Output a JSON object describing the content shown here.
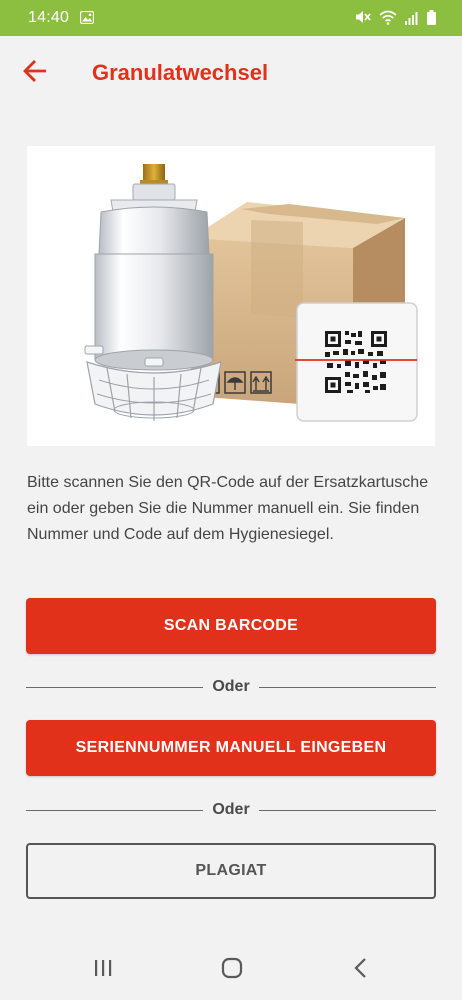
{
  "status_bar": {
    "time": "14:40",
    "icons": [
      "image-icon",
      "mute-icon",
      "wifi-icon",
      "signal-icon",
      "battery-icon"
    ]
  },
  "header": {
    "title": "Granulatwechsel",
    "back_icon": "arrow-left-icon"
  },
  "hero": {
    "illustration": "filter-cartridge-box-qr-code"
  },
  "instructions": "Bitte scannen Sie den QR-Code auf der Ersatzkartusche ein oder geben Sie die Nummer manuell ein. Sie finden Nummer und Code auf dem Hygienesiegel.",
  "actions": {
    "scan_label": "SCAN BARCODE",
    "divider1": "Oder",
    "manual_label": "SERIENNUMMER MANUELL EINGEBEN",
    "divider2": "Oder",
    "plagiat_label": "PLAGIAT"
  },
  "nav_bar": {
    "icons": [
      "recent-apps-icon",
      "home-icon",
      "back-icon"
    ]
  },
  "colors": {
    "accent": "#e2311a",
    "status_bar": "#8cbf3f",
    "background": "#f2f2f2"
  }
}
